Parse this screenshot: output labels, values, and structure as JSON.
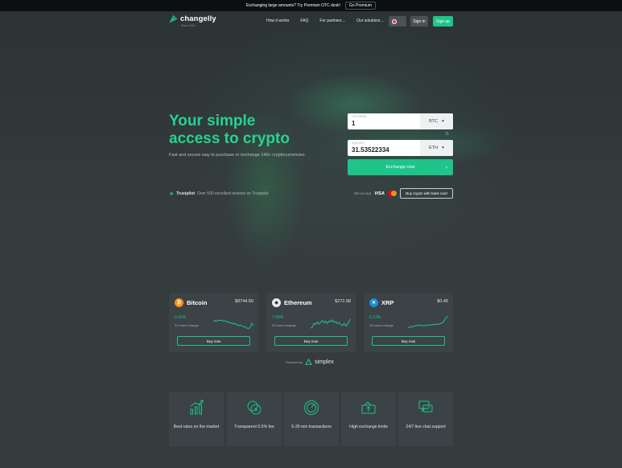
{
  "banner": {
    "text": "Exchanging large amounts? Try Premium OTC desk!",
    "button": "Go Premium"
  },
  "header": {
    "logo": "changelly",
    "logo_sub": "Since 2015",
    "nav": [
      "How it works",
      "FAQ",
      "For partners",
      "Our solutions"
    ],
    "sign_in": "Sign in",
    "sign_up": "Sign up"
  },
  "hero": {
    "title_line1": "Your simple",
    "title_line2": "access to crypto",
    "subtitle": "Fast and secure way to purchase or exchange 140+ cryptocurrencies",
    "trustpilot": "Trustpilot",
    "trust_text": "Over 500 excellent reviews on Trustpilot"
  },
  "exchange": {
    "send_label": "YOU SEND",
    "send_value": "1",
    "send_currency": "BTC",
    "get_label": "YOU GET",
    "get_value": "31.53522334",
    "get_currency": "ETH",
    "button": "Exchange now",
    "we_accept": "We accept",
    "visa": "VISA",
    "bank_button": "Buy crypto with bank card"
  },
  "coins": [
    {
      "name": "Bitcoin",
      "price": "$8744.50",
      "change": "0.42%",
      "change_label": "24 hours change",
      "button": "Buy now",
      "color": "#f7931a",
      "symbol": "₿",
      "spark": [
        0.55,
        0.62,
        0.58,
        0.66,
        0.6,
        0.64,
        0.58,
        0.6,
        0.52,
        0.56,
        0.45,
        0.48,
        0.4,
        0.44,
        0.35,
        0.3,
        0.34,
        0.28,
        0.24,
        0.22,
        0.15,
        0.12,
        0.18,
        0.45,
        0.3
      ]
    },
    {
      "name": "Ethereum",
      "price": "$272.98",
      "change": "7.08%",
      "change_label": "24 hours change",
      "button": "Buy now",
      "color": "#e8ecee",
      "symbol": "◆",
      "spark": [
        0.15,
        0.2,
        0.45,
        0.38,
        0.52,
        0.4,
        0.5,
        0.62,
        0.48,
        0.58,
        0.44,
        0.6,
        0.52,
        0.66,
        0.5,
        0.56,
        0.42,
        0.5,
        0.36,
        0.3,
        0.45,
        0.28,
        0.38,
        0.6,
        0.72
      ]
    },
    {
      "name": "XRP",
      "price": "$0.45",
      "change": "6.13%",
      "change_label": "24 hours change",
      "button": "Buy now",
      "color": "#1a8fd6",
      "symbol": "✕",
      "spark": [
        0.18,
        0.2,
        0.26,
        0.22,
        0.3,
        0.28,
        0.35,
        0.3,
        0.33,
        0.28,
        0.3,
        0.34,
        0.3,
        0.36,
        0.34,
        0.38,
        0.36,
        0.4,
        0.38,
        0.42,
        0.46,
        0.52,
        0.7,
        0.82,
        0.88
      ]
    }
  ],
  "powered": {
    "label": "Powered by",
    "brand": "simplex"
  },
  "features": [
    {
      "text": "Best rates on the market",
      "icon": "chart-bars-icon"
    },
    {
      "text": "Transparent 0.5% fee",
      "icon": "coins-icon"
    },
    {
      "text": "5-30 min transactions",
      "icon": "speedometer-icon"
    },
    {
      "text": "High exchange limits",
      "icon": "wallet-icon"
    },
    {
      "text": "24/7 live chat support",
      "icon": "chat-icon"
    }
  ],
  "colors": {
    "accent": "#1ec48a",
    "background": "#333b3d",
    "card": "#3b4346"
  }
}
